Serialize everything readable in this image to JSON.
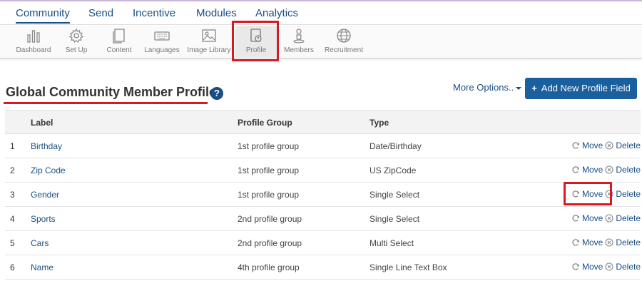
{
  "top_nav": [
    {
      "label": "Community",
      "active": true
    },
    {
      "label": "Send",
      "active": false
    },
    {
      "label": "Incentive",
      "active": false
    },
    {
      "label": "Modules",
      "active": false
    },
    {
      "label": "Analytics",
      "active": false
    }
  ],
  "toolbar": [
    {
      "label": "Dashboard",
      "icon": "bar-chart-icon"
    },
    {
      "label": "Set Up",
      "icon": "gear-icon"
    },
    {
      "label": "Content",
      "icon": "document-icon"
    },
    {
      "label": "Languages",
      "icon": "keyboard-icon"
    },
    {
      "label": "Image Library",
      "icon": "image-icon"
    },
    {
      "label": "Profile",
      "icon": "profile-card-icon",
      "active": true
    },
    {
      "label": "Members",
      "icon": "person-icon"
    },
    {
      "label": "Recruitment",
      "icon": "globe-icon"
    }
  ],
  "page": {
    "title": "Global Community Member Profile",
    "help_icon": "?",
    "more_options": "More Options..",
    "add_button": "Add New Profile Field",
    "add_button_icon": "+"
  },
  "table": {
    "headers": {
      "label": "Label",
      "group": "Profile Group",
      "type": "Type"
    },
    "rows": [
      {
        "num": "1",
        "label": "Birthday",
        "group": "1st profile group",
        "type": "Date/Birthday"
      },
      {
        "num": "2",
        "label": "Zip Code",
        "group": "1st profile group",
        "type": "US ZipCode"
      },
      {
        "num": "3",
        "label": "Gender",
        "group": "1st profile group",
        "type": "Single Select"
      },
      {
        "num": "4",
        "label": "Sports",
        "group": "2nd profile group",
        "type": "Single Select"
      },
      {
        "num": "5",
        "label": "Cars",
        "group": "2nd profile group",
        "type": "Multi Select"
      },
      {
        "num": "6",
        "label": "Name",
        "group": "4th profile group",
        "type": "Single Line Text Box"
      }
    ],
    "move_label": "Move",
    "delete_label": "Delete"
  },
  "colors": {
    "link": "#1a4f86",
    "button": "#1a5f9e",
    "highlight": "#d71920"
  }
}
